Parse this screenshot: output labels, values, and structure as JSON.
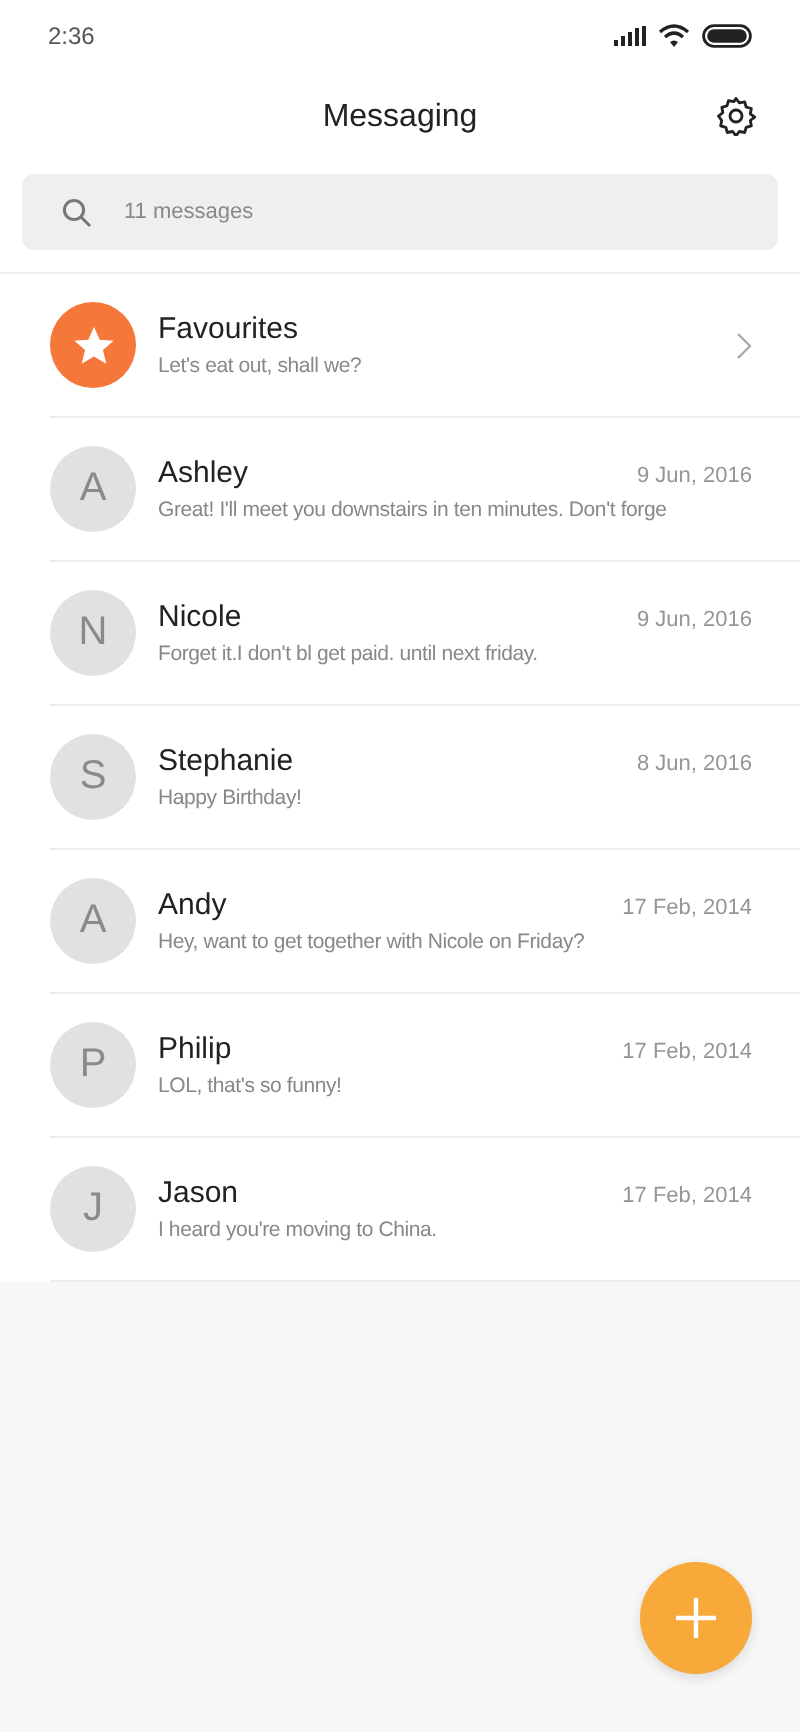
{
  "status_bar": {
    "time": "2:36"
  },
  "header": {
    "title": "Messaging"
  },
  "search": {
    "placeholder": "11 messages"
  },
  "conversations": [
    {
      "kind": "favourite",
      "name": "Favourites",
      "message": "Let's eat out, shall we?"
    },
    {
      "kind": "contact",
      "initial": "A",
      "name": "Ashley",
      "date": "9 Jun, 2016",
      "message": "Great! I'll meet you downstairs in ten minutes. Don't forge"
    },
    {
      "kind": "contact",
      "initial": "N",
      "name": "Nicole",
      "date": "9 Jun, 2016",
      "message": "Forget it.I don't bl get paid. until next friday."
    },
    {
      "kind": "contact",
      "initial": "S",
      "name": "Stephanie",
      "date": "8 Jun, 2016",
      "message": "Happy Birthday!"
    },
    {
      "kind": "contact",
      "initial": "A",
      "name": "Andy",
      "date": "17 Feb, 2014",
      "message": "Hey, want to get together with Nicole on Friday?"
    },
    {
      "kind": "contact",
      "initial": "P",
      "name": "Philip",
      "date": "17 Feb, 2014",
      "message": "LOL, that's so funny!"
    },
    {
      "kind": "contact",
      "initial": "J",
      "name": "Jason",
      "date": "17 Feb, 2014",
      "message": "I heard you're moving to China."
    }
  ]
}
